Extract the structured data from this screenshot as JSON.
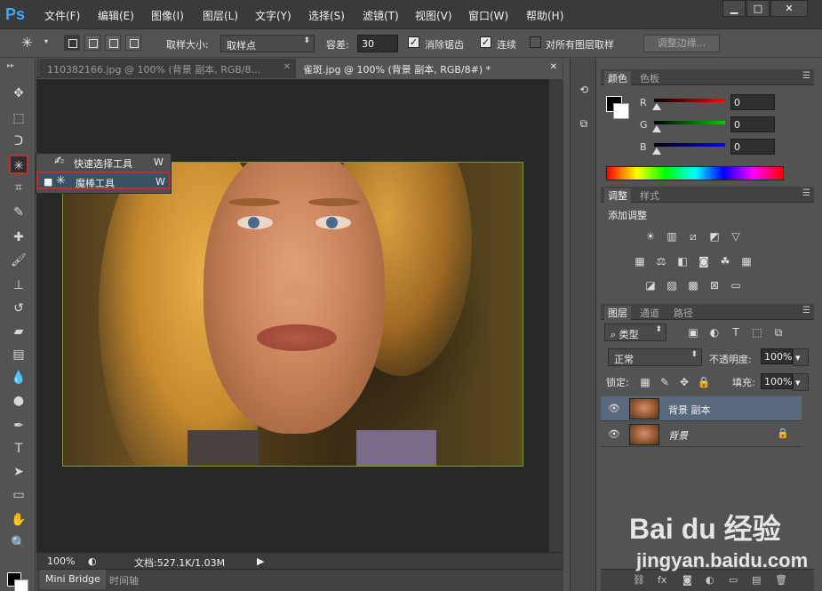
{
  "app": {
    "logo": "Ps"
  },
  "menu": [
    "文件(F)",
    "编辑(E)",
    "图像(I)",
    "图层(L)",
    "文字(Y)",
    "选择(S)",
    "滤镜(T)",
    "视图(V)",
    "窗口(W)",
    "帮助(H)"
  ],
  "window_controls": {
    "minimize": "▁",
    "maximize": "□",
    "close": "✕"
  },
  "options": {
    "sample_size_label": "取样大小:",
    "sample_size_value": "取样点",
    "tolerance_label": "容差:",
    "tolerance_value": "30",
    "anti_alias_label": "消除锯齿",
    "anti_alias_checked": true,
    "contiguous_label": "连续",
    "contiguous_checked": true,
    "sample_all_label": "对所有图层取样",
    "sample_all_checked": false,
    "refine_edge_label": "调整边缘..."
  },
  "flyout": {
    "items": [
      {
        "label": "快速选择工具",
        "shortcut": "W",
        "icon": "quick-selection-icon"
      },
      {
        "label": "魔棒工具",
        "shortcut": "W",
        "icon": "magic-wand-icon",
        "bullet": "■"
      }
    ]
  },
  "tools": [
    {
      "name": "move-tool-icon",
      "glyph": "✥"
    },
    {
      "name": "marquee-tool-icon",
      "glyph": "⬚"
    },
    {
      "name": "lasso-tool-icon",
      "glyph": "ᑐ"
    },
    {
      "name": "magic-wand-tool-icon",
      "glyph": "✳"
    },
    {
      "name": "crop-tool-icon",
      "glyph": "⌗"
    },
    {
      "name": "eyedropper-tool-icon",
      "glyph": "✎"
    },
    {
      "name": "healing-brush-tool-icon",
      "glyph": "✚"
    },
    {
      "name": "brush-tool-icon",
      "glyph": "🖌"
    },
    {
      "name": "clone-stamp-tool-icon",
      "glyph": "⊥"
    },
    {
      "name": "history-brush-tool-icon",
      "glyph": "↺"
    },
    {
      "name": "eraser-tool-icon",
      "glyph": "▰"
    },
    {
      "name": "gradient-tool-icon",
      "glyph": "▤"
    },
    {
      "name": "blur-tool-icon",
      "glyph": "💧"
    },
    {
      "name": "dodge-tool-icon",
      "glyph": "●"
    },
    {
      "name": "pen-tool-icon",
      "glyph": "✒"
    },
    {
      "name": "type-tool-icon",
      "glyph": "T"
    },
    {
      "name": "path-selection-tool-icon",
      "glyph": "➤"
    },
    {
      "name": "rectangle-tool-icon",
      "glyph": "▭"
    },
    {
      "name": "hand-tool-icon",
      "glyph": "✋"
    },
    {
      "name": "zoom-tool-icon",
      "glyph": "🔍"
    }
  ],
  "doc_tabs": [
    {
      "label": "110382166.jpg @ 100% (背景 副本, RGB/8...",
      "close": "✕"
    },
    {
      "label": "雀斑.jpg @ 100% (背景 副本, RGB/8#) *",
      "close": "✕"
    }
  ],
  "status": {
    "zoom": "100%",
    "doc_info": "文档:527.1K/1.03M"
  },
  "bottom_tabs": [
    "Mini Bridge",
    "时间轴"
  ],
  "color_panel": {
    "tabs": [
      "颜色",
      "色板"
    ],
    "channels": [
      {
        "label": "R",
        "value": "0",
        "color": "#ff0000"
      },
      {
        "label": "G",
        "value": "0",
        "color": "#00cc00"
      },
      {
        "label": "B",
        "value": "0",
        "color": "#0000ff"
      }
    ]
  },
  "adjust_panel": {
    "tabs": [
      "调整",
      "样式"
    ],
    "heading": "添加调整"
  },
  "layers_panel": {
    "tabs": [
      "图层",
      "通道",
      "路径"
    ],
    "filter_label": "类型",
    "blend_mode": "正常",
    "opacity_label": "不透明度:",
    "opacity_value": "100%",
    "lock_label": "锁定:",
    "fill_label": "填充:",
    "fill_value": "100%",
    "layers": [
      {
        "name": "背景 副本",
        "selected": true,
        "locked": false
      },
      {
        "name": "背景",
        "selected": false,
        "locked": true
      }
    ]
  },
  "watermark": {
    "brand": "Bai du 经验",
    "url": "jingyan.baidu.com"
  }
}
